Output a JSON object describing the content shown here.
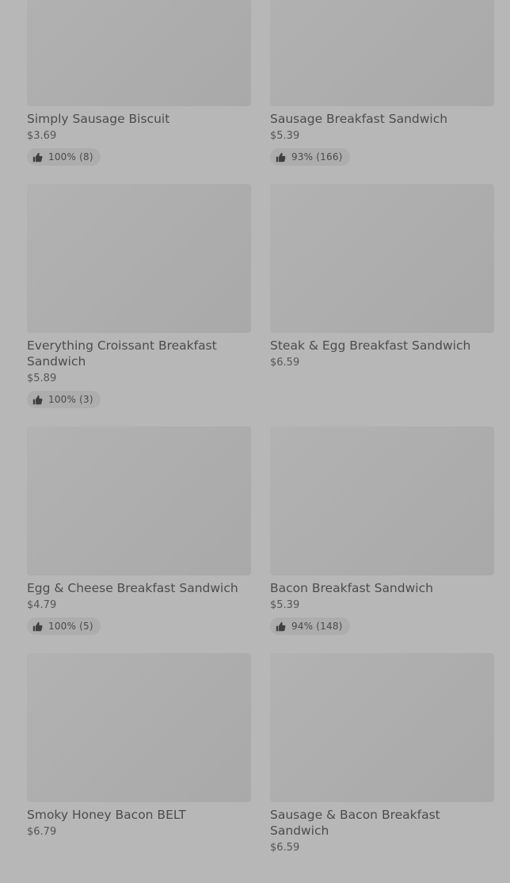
{
  "items": [
    {
      "name": "Simply Sausage Biscuit",
      "price": "$3.69",
      "rating": "100% (8)"
    },
    {
      "name": "Sausage Breakfast Sandwich",
      "price": "$5.39",
      "rating": "93% (166)"
    },
    {
      "name": "Everything Croissant Breakfast Sandwich",
      "price": "$5.89",
      "rating": "100% (3)"
    },
    {
      "name": "Steak & Egg Breakfast Sandwich",
      "price": "$6.59",
      "rating": ""
    },
    {
      "name": "Egg & Cheese Breakfast Sandwich",
      "price": "$4.79",
      "rating": "100% (5)"
    },
    {
      "name": "Bacon Breakfast Sandwich",
      "price": "$5.39",
      "rating": "94% (148)"
    },
    {
      "name": "Smoky Honey Bacon BELT",
      "price": "$6.79",
      "rating": ""
    },
    {
      "name": "Sausage & Bacon Breakfast Sandwich",
      "price": "$6.59",
      "rating": ""
    }
  ],
  "icons": {
    "rating": "thumbs-up-icon"
  },
  "colors": {
    "overlay": "#b7b7b7",
    "text": "#4c4c4c"
  }
}
